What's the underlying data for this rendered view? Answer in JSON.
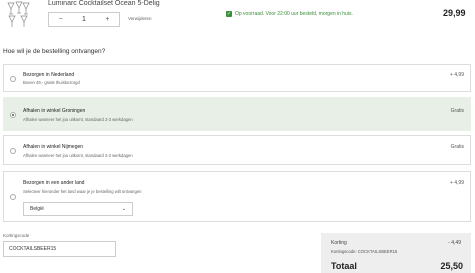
{
  "product": {
    "title": "Luminarc Cocktailset Ocean 5-Delig",
    "quantity": "1",
    "minus": "−",
    "plus": "+",
    "remove": "Verwijderen",
    "stock": "Op voorraad. Voor 22:00 uur besteld, morgen in huis.",
    "price": "29,99"
  },
  "delivery": {
    "heading": "Hoe wil je de bestelling ontvangen?",
    "options": [
      {
        "title": "Bezorgen in Nederland",
        "subtitle": "Boven 49,- gratis thuisbezorgd",
        "price": "+ 4,99",
        "selected": false
      },
      {
        "title": "Afhalen in winkel Groningen",
        "subtitle": "Afhalen wanneer het jou uitkomt, standaard 2-3 werkdagen",
        "price": "Gratis",
        "selected": true
      },
      {
        "title": "Afhalen in winkel Nijmegen",
        "subtitle": "Afhalen wanneer het jou uitkomt, standaard 2-3 werkdagen",
        "price": "Gratis",
        "selected": false
      },
      {
        "title": "Bezorgen in een ander land",
        "subtitle": "Selecteer hieronder het land waar je je bestelling wilt ontvangen",
        "price": "+ 4,99",
        "selected": false
      }
    ],
    "country": "België"
  },
  "coupon": {
    "label": "Kortingscode",
    "value": "COCKTAILSBEER15"
  },
  "summary": {
    "discount_label": "Korting",
    "discount_code": "Kortingscode: COCKTAILSBEER15",
    "discount_amount": "- 4,49",
    "total_label": "Totaal",
    "total_value": "25,50"
  },
  "colors": {
    "accent": "#3a8f3a",
    "selected_bg": "#e8efe6"
  }
}
